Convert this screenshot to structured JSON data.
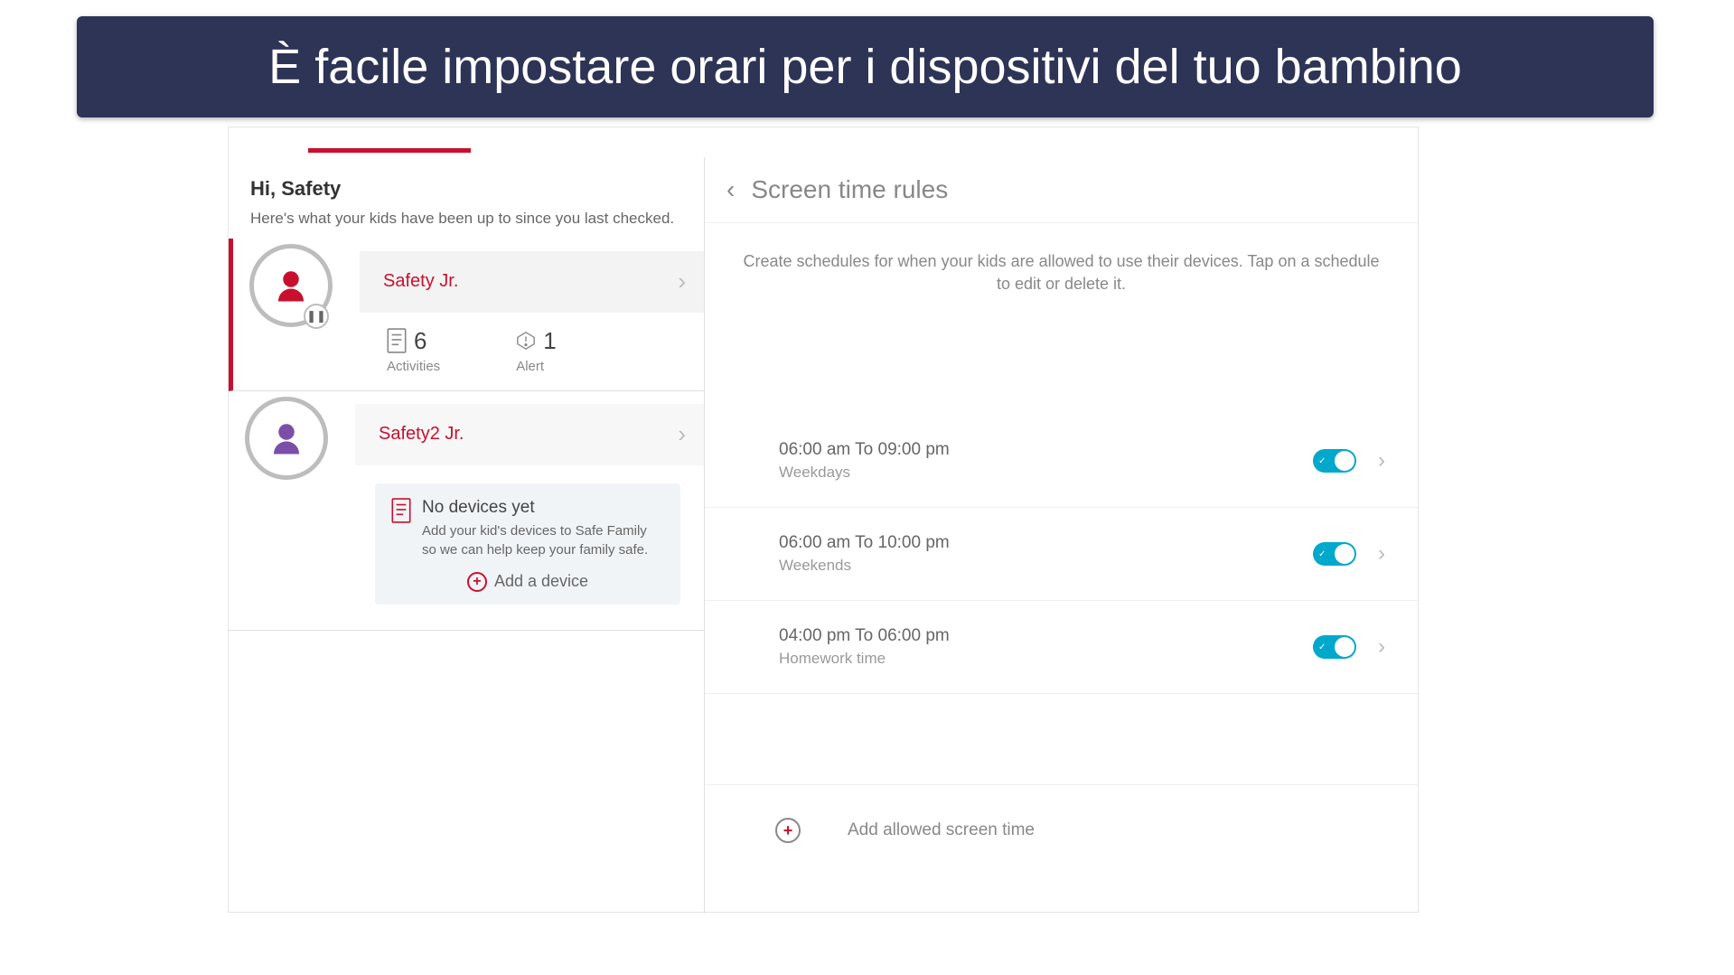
{
  "banner": {
    "text": "È facile impostare orari per i dispositivi del tuo bambino"
  },
  "sidebar": {
    "greeting_hi": "Hi, Safety",
    "greeting_sub": "Here's what your kids have been up to since you last checked.",
    "children": [
      {
        "name": "Safety Jr.",
        "avatar_color": "#c8102e",
        "paused": true,
        "stats": {
          "activities_count": "6",
          "activities_label": "Activities",
          "alert_count": "1",
          "alert_label": "Alert"
        }
      },
      {
        "name": "Safety2 Jr.",
        "avatar_color": "#7b4fa8",
        "no_devices": {
          "title": "No devices yet",
          "sub": "Add your kid's devices to Safe Family so we can help keep your family safe.",
          "add_label": "Add a device"
        }
      }
    ]
  },
  "main": {
    "title": "Screen time rules",
    "description": "Create schedules for when your kids are allowed to use their devices. Tap on a schedule to edit or delete it.",
    "schedules": [
      {
        "time": "06:00 am To 09:00 pm",
        "label": "Weekdays",
        "enabled": true
      },
      {
        "time": "06:00 am To 10:00 pm",
        "label": "Weekends",
        "enabled": true
      },
      {
        "time": "04:00 pm To 06:00 pm",
        "label": "Homework time",
        "enabled": true
      }
    ],
    "add_label": "Add allowed screen time"
  }
}
